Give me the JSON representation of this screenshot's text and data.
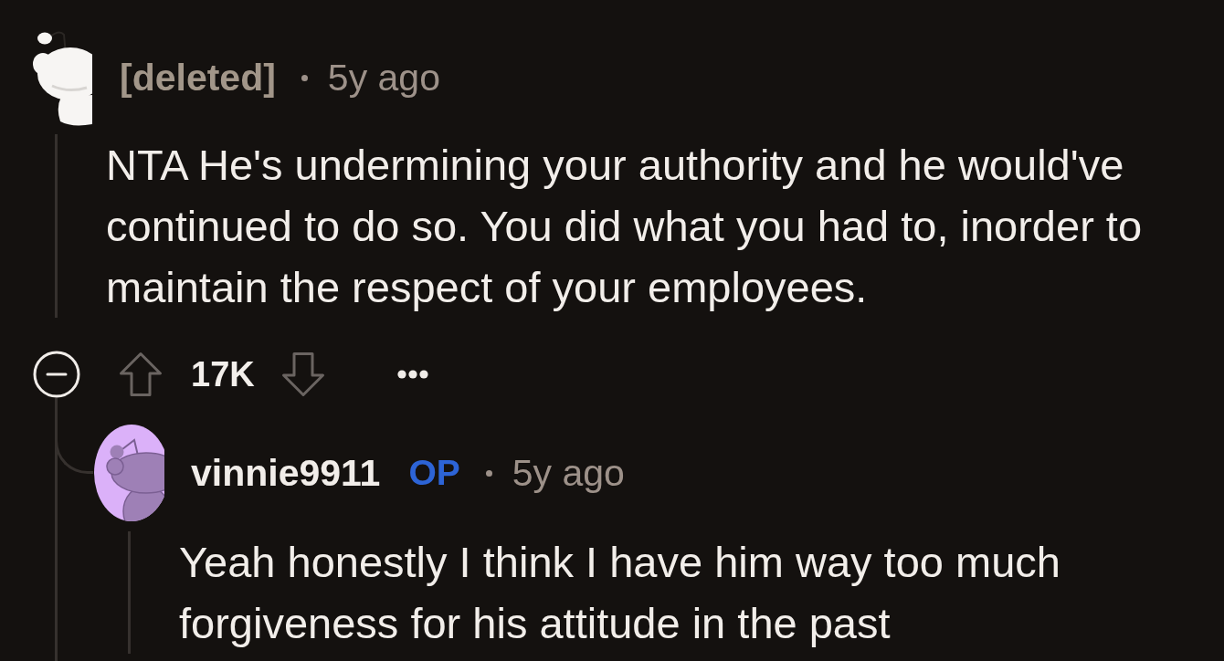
{
  "comments": [
    {
      "author": "[deleted]",
      "deleted": true,
      "time": "5y ago",
      "body": "NTA He's undermining your authority and he would've continued to do so. You did what you had to, inorder to maintain the respect of your employees.",
      "collapsed": false,
      "score": "17K",
      "replies": [
        {
          "author": "vinnie9911",
          "deleted": false,
          "badge": "OP",
          "time": "5y ago",
          "body": "Yeah honestly I think I have him way too much forgiveness for his attitude in the past"
        }
      ]
    }
  ]
}
